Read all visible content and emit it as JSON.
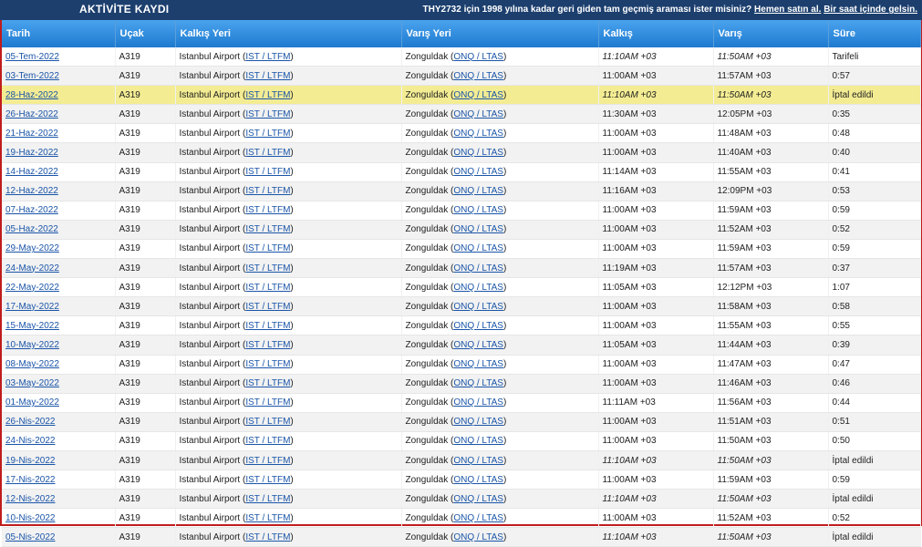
{
  "header": {
    "title": "AKTİVİTE KAYDI",
    "promo_text": "THY2732 için 1998 yılına kadar geri giden tam geçmiş araması ister misiniz? ",
    "promo_link1": "Hemen satın al.",
    "promo_link2": "Bir saat içinde gelsin."
  },
  "table": {
    "columns": [
      "Tarih",
      "Uçak",
      "Kalkış Yeri",
      "Varış Yeri",
      "Kalkış",
      "Varış",
      "Süre"
    ],
    "origin_name": "Istanbul Airport",
    "origin_code": "IST / LTFM",
    "dest_name": "Zonguldak",
    "dest_code": "ONQ / LTAS",
    "rows": [
      {
        "date": "05-Tem-2022",
        "aircraft": "A319",
        "dep": "11:10AM +03",
        "arr": "11:50AM +03",
        "dur": "Tarifeli",
        "est": true,
        "hl": false
      },
      {
        "date": "03-Tem-2022",
        "aircraft": "A319",
        "dep": "11:00AM +03",
        "arr": "11:57AM +03",
        "dur": "0:57",
        "est": false,
        "hl": false
      },
      {
        "date": "28-Haz-2022",
        "aircraft": "A319",
        "dep": "11:10AM +03",
        "arr": "11:50AM +03",
        "dur": "İptal edildi",
        "est": true,
        "hl": true
      },
      {
        "date": "26-Haz-2022",
        "aircraft": "A319",
        "dep": "11:30AM +03",
        "arr": "12:05PM +03",
        "dur": "0:35",
        "est": false,
        "hl": false
      },
      {
        "date": "21-Haz-2022",
        "aircraft": "A319",
        "dep": "11:00AM +03",
        "arr": "11:48AM +03",
        "dur": "0:48",
        "est": false,
        "hl": false
      },
      {
        "date": "19-Haz-2022",
        "aircraft": "A319",
        "dep": "11:00AM +03",
        "arr": "11:40AM +03",
        "dur": "0:40",
        "est": false,
        "hl": false
      },
      {
        "date": "14-Haz-2022",
        "aircraft": "A319",
        "dep": "11:14AM +03",
        "arr": "11:55AM +03",
        "dur": "0:41",
        "est": false,
        "hl": false
      },
      {
        "date": "12-Haz-2022",
        "aircraft": "A319",
        "dep": "11:16AM +03",
        "arr": "12:09PM +03",
        "dur": "0:53",
        "est": false,
        "hl": false
      },
      {
        "date": "07-Haz-2022",
        "aircraft": "A319",
        "dep": "11:00AM +03",
        "arr": "11:59AM +03",
        "dur": "0:59",
        "est": false,
        "hl": false
      },
      {
        "date": "05-Haz-2022",
        "aircraft": "A319",
        "dep": "11:00AM +03",
        "arr": "11:52AM +03",
        "dur": "0:52",
        "est": false,
        "hl": false
      },
      {
        "date": "29-May-2022",
        "aircraft": "A319",
        "dep": "11:00AM +03",
        "arr": "11:59AM +03",
        "dur": "0:59",
        "est": false,
        "hl": false
      },
      {
        "date": "24-May-2022",
        "aircraft": "A319",
        "dep": "11:19AM +03",
        "arr": "11:57AM +03",
        "dur": "0:37",
        "est": false,
        "hl": false
      },
      {
        "date": "22-May-2022",
        "aircraft": "A319",
        "dep": "11:05AM +03",
        "arr": "12:12PM +03",
        "dur": "1:07",
        "est": false,
        "hl": false
      },
      {
        "date": "17-May-2022",
        "aircraft": "A319",
        "dep": "11:00AM +03",
        "arr": "11:58AM +03",
        "dur": "0:58",
        "est": false,
        "hl": false
      },
      {
        "date": "15-May-2022",
        "aircraft": "A319",
        "dep": "11:00AM +03",
        "arr": "11:55AM +03",
        "dur": "0:55",
        "est": false,
        "hl": false
      },
      {
        "date": "10-May-2022",
        "aircraft": "A319",
        "dep": "11:05AM +03",
        "arr": "11:44AM +03",
        "dur": "0:39",
        "est": false,
        "hl": false
      },
      {
        "date": "08-May-2022",
        "aircraft": "A319",
        "dep": "11:00AM +03",
        "arr": "11:47AM +03",
        "dur": "0:47",
        "est": false,
        "hl": false
      },
      {
        "date": "03-May-2022",
        "aircraft": "A319",
        "dep": "11:00AM +03",
        "arr": "11:46AM +03",
        "dur": "0:46",
        "est": false,
        "hl": false
      },
      {
        "date": "01-May-2022",
        "aircraft": "A319",
        "dep": "11:11AM +03",
        "arr": "11:56AM +03",
        "dur": "0:44",
        "est": false,
        "hl": false
      },
      {
        "date": "26-Nis-2022",
        "aircraft": "A319",
        "dep": "11:00AM +03",
        "arr": "11:51AM +03",
        "dur": "0:51",
        "est": false,
        "hl": false
      },
      {
        "date": "24-Nis-2022",
        "aircraft": "A319",
        "dep": "11:00AM +03",
        "arr": "11:50AM +03",
        "dur": "0:50",
        "est": false,
        "hl": false
      },
      {
        "date": "19-Nis-2022",
        "aircraft": "A319",
        "dep": "11:10AM +03",
        "arr": "11:50AM +03",
        "dur": "İptal edildi",
        "est": true,
        "hl": false
      },
      {
        "date": "17-Nis-2022",
        "aircraft": "A319",
        "dep": "11:00AM +03",
        "arr": "11:59AM +03",
        "dur": "0:59",
        "est": false,
        "hl": false
      },
      {
        "date": "12-Nis-2022",
        "aircraft": "A319",
        "dep": "11:10AM +03",
        "arr": "11:50AM +03",
        "dur": "İptal edildi",
        "est": true,
        "hl": false
      },
      {
        "date": "10-Nis-2022",
        "aircraft": "A319",
        "dep": "11:00AM +03",
        "arr": "11:52AM +03",
        "dur": "0:52",
        "est": false,
        "hl": false
      },
      {
        "date": "05-Nis-2022",
        "aircraft": "A319",
        "dep": "11:10AM +03",
        "arr": "11:50AM +03",
        "dur": "İptal edildi",
        "est": true,
        "hl": false
      }
    ]
  }
}
